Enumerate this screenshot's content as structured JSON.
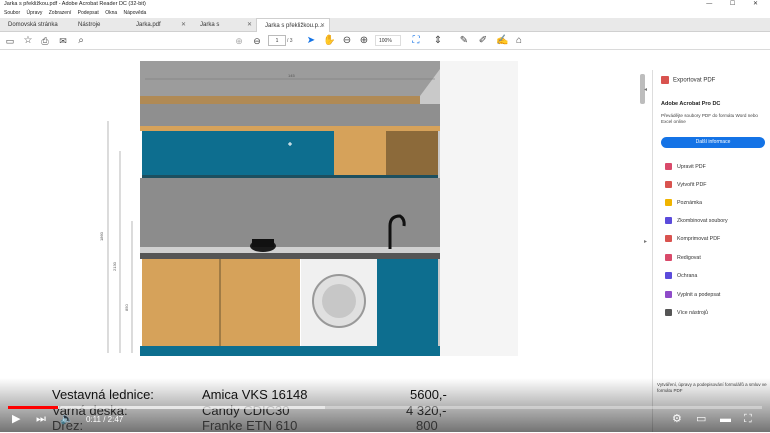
{
  "window": {
    "title": "Jarka s překližkou.pdf - Adobe Acrobat Reader DC (32-bit)",
    "controls": "— ☐ ✕"
  },
  "menu": [
    "Soubor",
    "Úpravy",
    "Zobrazení",
    "Podepsat",
    "Okna",
    "Nápověda"
  ],
  "tabs": [
    {
      "label": "Domovská stránka",
      "active": false
    },
    {
      "label": "Nástroje",
      "active": false
    },
    {
      "label": "Jarka.pdf",
      "active": false
    },
    {
      "label": "Jarka s překližkou.pdf",
      "active": false
    },
    {
      "label": "Jarka s překližkou.p...",
      "active": true
    }
  ],
  "toolbar": {
    "page_current": "1",
    "page_total": "/ 3",
    "zoom": "100%"
  },
  "drawing": {
    "dim_top": "145",
    "dim_left1": "1860",
    "dim_left2": "2130",
    "dim_left3": "850"
  },
  "right_panel": {
    "export_label": "Exportovat PDF",
    "pro_title": "Adobe Acrobat Pro DC",
    "pro_desc": "Převádějte soubory PDF do formátu Word nebo Excel online",
    "more_info_button": "Další informace",
    "items": [
      {
        "label": "Upravit PDF",
        "color": "#d94a6a"
      },
      {
        "label": "Vytvořit PDF",
        "color": "#d9534f"
      },
      {
        "label": "Poznámka",
        "color": "#f0b400"
      },
      {
        "label": "Zkombinovat soubory",
        "color": "#5b4bdb"
      },
      {
        "label": "Komprimovat PDF",
        "color": "#d9534f"
      },
      {
        "label": "Redigovat",
        "color": "#d94a6a"
      },
      {
        "label": "Ochrana",
        "color": "#5b4bdb"
      },
      {
        "label": "Vyplnit a podepsat",
        "color": "#8f4bc9"
      },
      {
        "label": "Více nástrojů",
        "color": "#555555"
      }
    ],
    "footer": "Vytváření, úpravy a podepisování formulářů a smluv ve formátu PDF"
  },
  "captions": [
    {
      "label": "Vestavná lednice:",
      "model": "Amica VKS 16148",
      "price": "5600,-"
    },
    {
      "label": "Varná deska:",
      "model": "Candy CDIC30",
      "price": "4 320,-"
    },
    {
      "label": "Dřez:",
      "model": "Franke ETN 610",
      "price": "800"
    }
  ],
  "video": {
    "current_time": "0:11",
    "duration": "2:47",
    "played_fraction": 0.066,
    "buffered_fraction": 0.42
  }
}
